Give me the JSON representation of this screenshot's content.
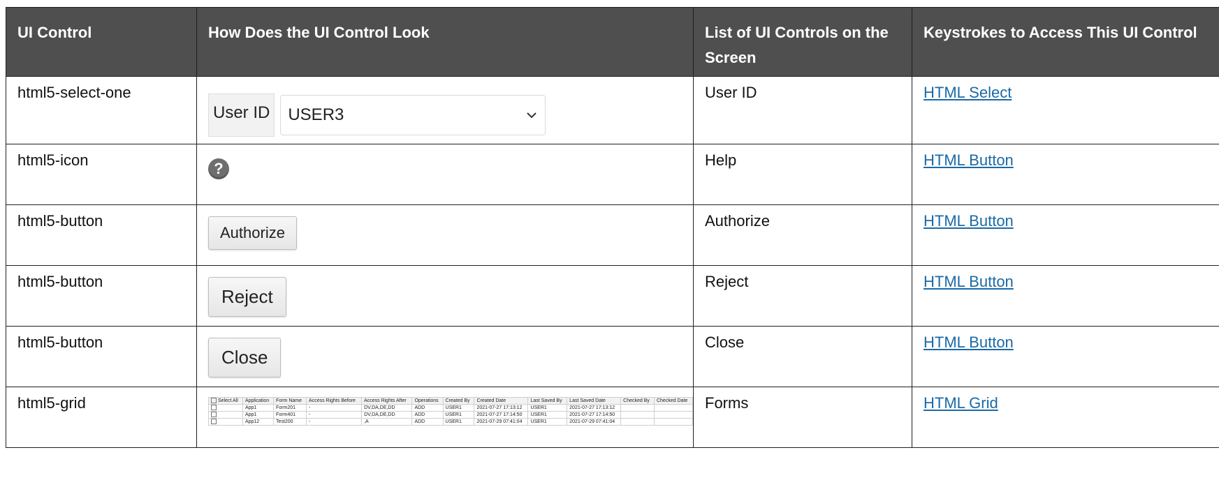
{
  "table": {
    "headers": [
      "UI Control",
      "How Does the UI Control Look",
      "List of UI Controls on the Screen",
      "Keystrokes to Access This UI Control"
    ],
    "rows": [
      {
        "control": "html5-select-one",
        "list": "User ID",
        "keystroke": "HTML Select",
        "visual": {
          "label": "User ID",
          "value": "USER3"
        }
      },
      {
        "control": "html5-icon",
        "list": "Help",
        "keystroke": "HTML Button",
        "visual": {
          "glyph": "?"
        }
      },
      {
        "control": "html5-button",
        "list": "Authorize",
        "keystroke": "HTML Button",
        "visual": {
          "label": "Authorize"
        }
      },
      {
        "control": "html5-button",
        "list": "Reject",
        "keystroke": "HTML Button",
        "visual": {
          "label": "Reject"
        }
      },
      {
        "control": "html5-button",
        "list": "Close",
        "keystroke": "HTML Button",
        "visual": {
          "label": "Close"
        }
      },
      {
        "control": "html5-grid",
        "list": "Forms",
        "keystroke": "HTML Grid",
        "visual": {
          "columns": [
            "Select All",
            "Application",
            "Form Name",
            "Access Rights Before",
            "Access Rights After",
            "Operations",
            "Created By",
            "Created Date",
            "Last Saved By",
            "Last Saved Date",
            "Checked By",
            "Checked Date"
          ],
          "rows": [
            [
              "",
              "App1",
              "Form201",
              "-",
              "DV,DA,DE,DD",
              "ADD",
              "USER1",
              "2021-07-27 17:13:12",
              "USER1",
              "2021-07-27 17:13:12",
              "",
              ""
            ],
            [
              "",
              "App1",
              "Form401",
              "-",
              "DV,DA,DE,DD",
              "ADD",
              "USER1",
              "2021-07-27 17:14:50",
              "USER1",
              "2021-07-27 17:14:50",
              "",
              ""
            ],
            [
              "",
              "App12",
              "Test200",
              "-",
              ",A",
              "ADD",
              "USER1",
              "2021-07-29 07:41:04",
              "USER1",
              "2021-07-29 07:41:04",
              "",
              ""
            ]
          ]
        }
      }
    ]
  },
  "colors": {
    "header_bg": "#4f4f4f",
    "link": "#1a6aa8"
  }
}
